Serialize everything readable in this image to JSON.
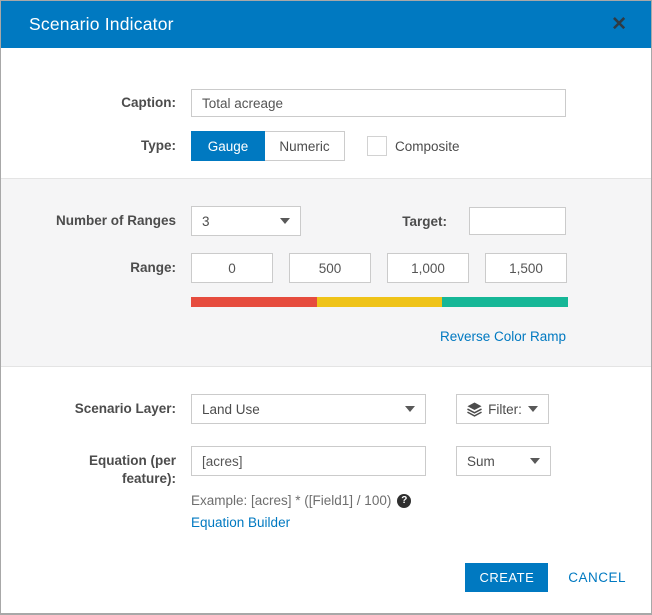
{
  "header": {
    "title": "Scenario Indicator",
    "close_icon": "✕"
  },
  "caption": {
    "label": "Caption:",
    "value": "Total acreage"
  },
  "type": {
    "label": "Type:",
    "gauge_option": "Gauge",
    "numeric_option": "Numeric",
    "selected": "Gauge",
    "composite_label": "Composite",
    "composite_checked": false
  },
  "ranges": {
    "number_label": "Number of Ranges",
    "number_value": "3",
    "target_label": "Target:",
    "target_value": "",
    "range_label": "Range:",
    "values": [
      "0",
      "500",
      "1,000",
      "1,500"
    ],
    "ramp_colors": [
      "#e64c3e",
      "#efc319",
      "#16b797"
    ],
    "reverse_link": "Reverse Color Ramp"
  },
  "layer": {
    "label": "Scenario Layer:",
    "value": "Land Use",
    "filter_label": "Filter:"
  },
  "equation": {
    "label_line1": "Equation (per",
    "label_line2": "feature):",
    "value": "[acres]",
    "aggregate_value": "Sum",
    "example": "Example: [acres] * ([Field1] / 100)",
    "help_icon": "?",
    "builder_link": "Equation Builder"
  },
  "footer": {
    "create_label": "CREATE",
    "cancel_label": "CANCEL"
  },
  "colors": {
    "accent": "#0079c1"
  }
}
